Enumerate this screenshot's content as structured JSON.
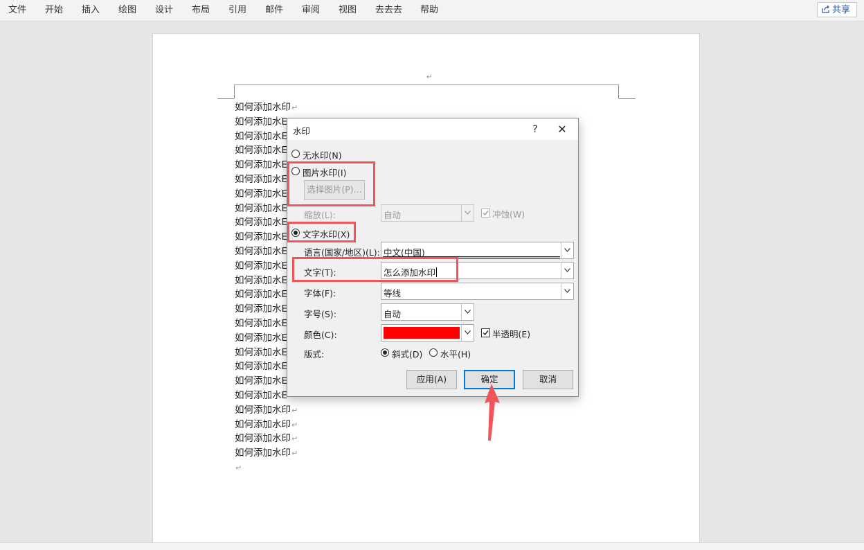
{
  "ribbon": {
    "tabs": [
      "文件",
      "开始",
      "插入",
      "绘图",
      "设计",
      "布局",
      "引用",
      "邮件",
      "审阅",
      "视图",
      "去去去",
      "帮助"
    ],
    "share_label": "共享"
  },
  "document": {
    "header_mark": "↵",
    "line_text": "如何添加水印",
    "paragraph_mark": "↵",
    "truncated_text": "如何添加水E",
    "empty_mark": "↵"
  },
  "dialog": {
    "title": "水印",
    "help": "?",
    "close": "✕",
    "no_watermark_label": "无水印(N)",
    "picture_watermark_label": "图片水印(I)",
    "select_picture_button": "选择图片(P)...",
    "scale_label": "缩放(L):",
    "scale_value": "自动",
    "washout_label": "冲蚀(W)",
    "text_watermark_label": "文字水印(X)",
    "language_label": "语言(国家/地区)(L):",
    "language_value": "中文(中国)",
    "text_label": "文字(T):",
    "text_value": "怎么添加水印",
    "font_label": "字体(F):",
    "font_value": "等线",
    "size_label": "字号(S):",
    "size_value": "自动",
    "color_label": "颜色(C):",
    "color_value": "#ff0000",
    "semi_transparent_label": "半透明(E)",
    "layout_label": "版式:",
    "diagonal_label": "斜式(D)",
    "horizontal_label": "水平(H)",
    "apply_button": "应用(A)",
    "ok_button": "确定",
    "cancel_button": "取消",
    "selected_type": "text",
    "semi_transparent": true,
    "washout": true,
    "layout": "diagonal"
  },
  "annotation": {
    "color": "#f0555b"
  }
}
